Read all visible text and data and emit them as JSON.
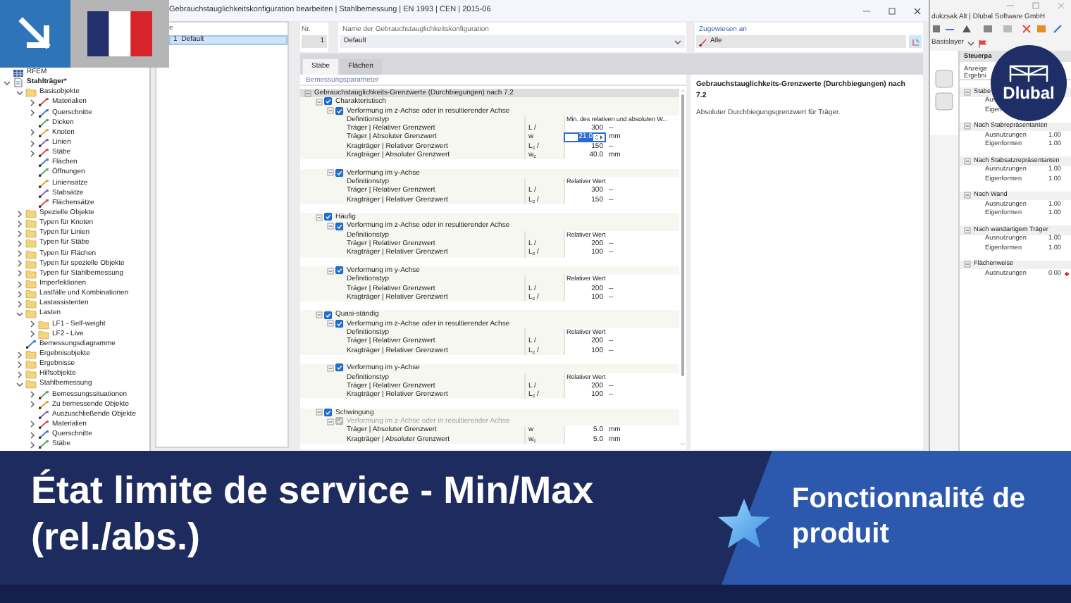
{
  "window": {
    "title": "Gebrauchstauglichkeitskonfiguration bearbeiten | Stahlbemessung | EN 1993 | CEN | 2015-06"
  },
  "navigator": {
    "items": [
      {
        "label": "RFEM",
        "kind": "app"
      },
      {
        "label": "Stahlträger*",
        "kind": "model",
        "expanded": true,
        "children": [
          {
            "label": "Basisobjekte",
            "kind": "folder",
            "expanded": true,
            "children": [
              {
                "label": "Materialien",
                "kind": "object",
                "expanded": false
              },
              {
                "label": "Querschnitte",
                "kind": "object",
                "expanded": false
              },
              {
                "label": "Dicken",
                "kind": "object"
              },
              {
                "label": "Knoten",
                "kind": "object",
                "expanded": false
              },
              {
                "label": "Linien",
                "kind": "object",
                "expanded": false
              },
              {
                "label": "Stäbe",
                "kind": "object",
                "expanded": false
              },
              {
                "label": "Flächen",
                "kind": "object"
              },
              {
                "label": "Öffnungen",
                "kind": "object"
              },
              {
                "label": "Liniensätze",
                "kind": "object"
              },
              {
                "label": "Stabsätze",
                "kind": "object"
              },
              {
                "label": "Flächensätze",
                "kind": "object"
              }
            ]
          },
          {
            "label": "Spezielle Objekte",
            "kind": "folder",
            "expanded": false
          },
          {
            "label": "Typen für Knoten",
            "kind": "folder",
            "expanded": false
          },
          {
            "label": "Typen für Linien",
            "kind": "folder",
            "expanded": false
          },
          {
            "label": "Typen für Stäbe",
            "kind": "folder",
            "expanded": false
          },
          {
            "label": "Typen für Flächen",
            "kind": "folder",
            "expanded": false
          },
          {
            "label": "Typen für spezielle Objekte",
            "kind": "folder",
            "expanded": false
          },
          {
            "label": "Typen für Stahlbemessung",
            "kind": "folder",
            "expanded": false
          },
          {
            "label": "Imperfektionen",
            "kind": "folder",
            "expanded": false
          },
          {
            "label": "Lastfälle und Kombinationen",
            "kind": "folder",
            "expanded": false
          },
          {
            "label": "Lastassistenten",
            "kind": "folder",
            "expanded": false
          },
          {
            "label": "Lasten",
            "kind": "folder",
            "expanded": true,
            "children": [
              {
                "label": "LF1 - Self-weight",
                "kind": "folder",
                "expanded": false
              },
              {
                "label": "LF2 - Live",
                "kind": "folder",
                "expanded": false
              }
            ]
          },
          {
            "label": "Bemessungsdiagramme",
            "kind": "object"
          },
          {
            "label": "Ergebnisobjekte",
            "kind": "folder",
            "expanded": false
          },
          {
            "label": "Ergebnisse",
            "kind": "folder",
            "expanded": false
          },
          {
            "label": "Hilfsobjekte",
            "kind": "folder",
            "expanded": false
          },
          {
            "label": "Stahlbemessung",
            "kind": "folder",
            "expanded": true,
            "children": [
              {
                "label": "Bemessungssituationen",
                "kind": "object",
                "expanded": false
              },
              {
                "label": "Zu bemessende Objekte",
                "kind": "object",
                "expanded": false
              },
              {
                "label": "Auszuschließende Objekte",
                "kind": "object"
              },
              {
                "label": "Materialien",
                "kind": "object",
                "expanded": false
              },
              {
                "label": "Querschnitte",
                "kind": "object",
                "expanded": false
              },
              {
                "label": "Stäbe",
                "kind": "object",
                "expanded": false
              }
            ]
          }
        ]
      }
    ]
  },
  "config_list": {
    "header": "e",
    "items": [
      {
        "number": "1",
        "label": "Default",
        "selected": true
      }
    ]
  },
  "config": {
    "number_label": "Nr.",
    "number": "1",
    "name_label": "Name der Gebrauchstauglichkeitskonfiguration",
    "name": "Default",
    "assigned_label": "Zugewiesen an",
    "assigned": "Alle"
  },
  "tabs": [
    {
      "label": "Stäbe",
      "selected": true
    },
    {
      "label": "Flächen",
      "selected": false
    }
  ],
  "parameters": {
    "title": "Bemessungsparameter",
    "sections": [
      {
        "label": "Gebrauchstauglichkeits-Grenzwerte (Durchbiegungen) nach 7.2",
        "expanded": true,
        "groups": [
          {
            "label": "Charakteristisch",
            "checked": true,
            "expanded": true,
            "subgroups": [
              {
                "label": "Verformung im z-Achse oder in resultierender Achse",
                "checked": true,
                "expanded": true,
                "disabled": false,
                "rows": [
                  {
                    "kind": "type",
                    "label": "Definitionstyp",
                    "value": "Min. des relativen und absoluten W..."
                  },
                  {
                    "kind": "limit",
                    "label": "Träger | Relativer Grenzwert",
                    "symbol": "L /",
                    "value": "300",
                    "unit": "--",
                    "editing": false
                  },
                  {
                    "kind": "limit",
                    "label": "Träger | Absoluter Grenzwert",
                    "symbol": "w",
                    "value": "21.0",
                    "unit": "mm",
                    "editing": true
                  },
                  {
                    "kind": "limit",
                    "label": "Kragträger | Relativer Grenzwert",
                    "symbol": "L$_{c}$ /",
                    "value": "150",
                    "unit": "--",
                    "editing": false
                  },
                  {
                    "kind": "limit",
                    "label": "Kragträger | Absoluter Grenzwert",
                    "symbol": "w$_{c}$",
                    "value": "40.0",
                    "unit": "mm",
                    "editing": false
                  }
                ]
              },
              {
                "label": "Verformung im y-Achse",
                "checked": true,
                "expanded": true,
                "disabled": false,
                "rows": [
                  {
                    "kind": "type",
                    "label": "Definitionstyp",
                    "value": "Relativer Wert"
                  },
                  {
                    "kind": "limit",
                    "label": "Träger | Relativer Grenzwert",
                    "symbol": "L /",
                    "value": "300",
                    "unit": "--",
                    "editing": false
                  },
                  {
                    "kind": "limit",
                    "label": "Kragträger | Relativer Grenzwert",
                    "symbol": "L$_{c}$ /",
                    "value": "150",
                    "unit": "--",
                    "editing": false
                  }
                ]
              }
            ]
          },
          {
            "label": "Häufig",
            "checked": true,
            "expanded": true,
            "subgroups": [
              {
                "label": "Verformung im z-Achse oder in resultierender Achse",
                "checked": true,
                "expanded": true,
                "disabled": false,
                "rows": [
                  {
                    "kind": "type",
                    "label": "Definitionstyp",
                    "value": "Relativer Wert"
                  },
                  {
                    "kind": "limit",
                    "label": "Träger | Relativer Grenzwert",
                    "symbol": "L /",
                    "value": "200",
                    "unit": "--",
                    "editing": false
                  },
                  {
                    "kind": "limit",
                    "label": "Kragträger | Relativer Grenzwert",
                    "symbol": "L$_{c}$ /",
                    "value": "100",
                    "unit": "--",
                    "editing": false
                  }
                ]
              },
              {
                "label": "Verformung im y-Achse",
                "checked": true,
                "expanded": true,
                "disabled": false,
                "rows": [
                  {
                    "kind": "type",
                    "label": "Definitionstyp",
                    "value": "Relativer Wert"
                  },
                  {
                    "kind": "limit",
                    "label": "Träger | Relativer Grenzwert",
                    "symbol": "L /",
                    "value": "200",
                    "unit": "--",
                    "editing": false
                  },
                  {
                    "kind": "limit",
                    "label": "Kragträger | Relativer Grenzwert",
                    "symbol": "L$_{c}$ /",
                    "value": "100",
                    "unit": "--",
                    "editing": false
                  }
                ]
              }
            ]
          },
          {
            "label": "Quasi-ständig",
            "checked": true,
            "expanded": true,
            "subgroups": [
              {
                "label": "Verformung im z-Achse oder in resultierender Achse",
                "checked": true,
                "expanded": true,
                "disabled": false,
                "rows": [
                  {
                    "kind": "type",
                    "label": "Definitionstyp",
                    "value": "Relativer Wert"
                  },
                  {
                    "kind": "limit",
                    "label": "Träger | Relativer Grenzwert",
                    "symbol": "L /",
                    "value": "200",
                    "unit": "--",
                    "editing": false
                  },
                  {
                    "kind": "limit",
                    "label": "Kragträger | Relativer Grenzwert",
                    "symbol": "L$_{c}$ /",
                    "value": "100",
                    "unit": "--",
                    "editing": false
                  }
                ]
              },
              {
                "label": "Verformung im y-Achse",
                "checked": true,
                "expanded": true,
                "disabled": false,
                "rows": [
                  {
                    "kind": "type",
                    "label": "Definitionstyp",
                    "value": "Relativer Wert"
                  },
                  {
                    "kind": "limit",
                    "label": "Träger | Relativer Grenzwert",
                    "symbol": "L /",
                    "value": "200",
                    "unit": "--",
                    "editing": false
                  },
                  {
                    "kind": "limit",
                    "label": "Kragträger | Relativer Grenzwert",
                    "symbol": "L$_{c}$ /",
                    "value": "100",
                    "unit": "--",
                    "editing": false
                  }
                ]
              }
            ]
          },
          {
            "label": "Schwingung",
            "checked": true,
            "expanded": true,
            "subgroups": [
              {
                "label": "Verformung im z-Achse oder in resultierender Achse",
                "checked": true,
                "expanded": true,
                "disabled": true,
                "rows": [
                  {
                    "kind": "limit",
                    "label": "Träger | Absoluter Grenzwert",
                    "symbol": "w",
                    "value": "5.0",
                    "unit": "mm",
                    "editing": false
                  },
                  {
                    "kind": "limit",
                    "label": "Kragträger | Absoluter Grenzwert",
                    "symbol": "w$_{c}$",
                    "value": "5.0",
                    "unit": "mm",
                    "editing": false
                  }
                ]
              }
            ]
          }
        ]
      }
    ]
  },
  "description": {
    "title": "Gebrauchstauglichkeits-Grenzwerte (Durchbiegungen) nach 7.2",
    "text": "Absoluter Durchbiegungsgrenzwert für Träger."
  },
  "background_app": {
    "title": "dukzsak Alt | Dlubal Software GmbH",
    "layer": "Basislayer",
    "panel": {
      "title": "Steuerpa",
      "lines": [
        "Anzeige",
        "Ergebni"
      ],
      "groups": [
        {
          "label": "Stabe",
          "expanded": true,
          "rows": [
            {
              "label": "Aus",
              "marker": false
            },
            {
              "label": "Eigen",
              "marker": false
            }
          ]
        },
        {
          "label": "Nach Stabrepräsentanten",
          "expanded": true,
          "rows": [
            {
              "label": "Ausnutzungen",
              "value": "1.00",
              "marker": false
            },
            {
              "label": "Eigenformen",
              "value": "1.00",
              "marker": false
            }
          ]
        },
        {
          "label": "Nach Stabsatzrepräsentanten",
          "expanded": true,
          "rows": [
            {
              "label": "Ausnutzungen",
              "value": "1.00",
              "marker": false
            },
            {
              "label": "Eigenformen",
              "value": "1.00",
              "marker": false
            }
          ]
        },
        {
          "label": "Nach Wand",
          "expanded": true,
          "rows": [
            {
              "label": "Ausnutzungen",
              "value": "1.00",
              "marker": false
            },
            {
              "label": "Eigenformen",
              "value": "1.00",
              "marker": false
            }
          ]
        },
        {
          "label": "Nach wandartigem Träger",
          "expanded": true,
          "rows": [
            {
              "label": "Ausnutzungen",
              "value": "1.00",
              "marker": false
            },
            {
              "label": "Eigenformen",
              "value": "1.00",
              "marker": false
            }
          ]
        },
        {
          "label": "Flächenweise",
          "expanded": true,
          "rows": [
            {
              "label": "Ausnutzungen",
              "value": "0.00",
              "marker": true
            }
          ]
        }
      ]
    }
  },
  "logo": {
    "text": "Dlubal"
  },
  "banner": {
    "title": "État limite de service - Min/Max (rel./abs.)",
    "tag": "Fonctionnalité de produit"
  }
}
